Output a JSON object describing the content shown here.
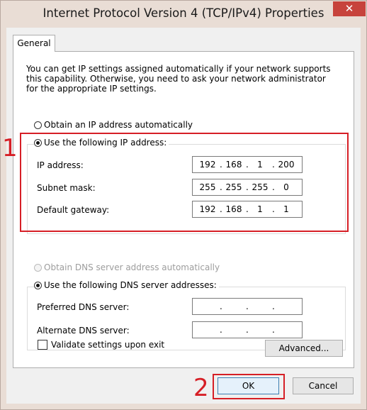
{
  "window": {
    "title": "Internet Protocol Version 4 (TCP/IPv4) Properties",
    "close_glyph": "✕"
  },
  "tabs": [
    {
      "label": "General",
      "selected": true
    }
  ],
  "intro_text": "You can get IP settings assigned automatically if your network supports this capability. Otherwise, you need to ask your network administrator for the appropriate IP settings.",
  "ip_options": {
    "auto_label": "Obtain an IP address automatically",
    "manual_label": "Use the following IP address:",
    "selected": "manual"
  },
  "ip_fields": [
    {
      "label": "IP address:",
      "octets": [
        "192",
        "168",
        "1",
        "200"
      ]
    },
    {
      "label": "Subnet mask:",
      "octets": [
        "255",
        "255",
        "255",
        "0"
      ]
    },
    {
      "label": "Default gateway:",
      "octets": [
        "192",
        "168",
        "1",
        "1"
      ]
    }
  ],
  "dns_options": {
    "auto_label": "Obtain DNS server address automatically",
    "manual_label": "Use the following DNS server addresses:",
    "selected": "manual",
    "auto_disabled": true
  },
  "dns_fields": [
    {
      "label": "Preferred DNS server:",
      "octets": [
        "",
        "",
        "",
        ""
      ]
    },
    {
      "label": "Alternate DNS server:",
      "octets": [
        "",
        "",
        "",
        ""
      ]
    }
  ],
  "validate": {
    "label": "Validate settings upon exit",
    "checked": false
  },
  "buttons": {
    "advanced": "Advanced...",
    "ok": "OK",
    "cancel": "Cancel"
  },
  "annotations": {
    "step1": "1",
    "step2": "2",
    "color": "#d61f26"
  }
}
